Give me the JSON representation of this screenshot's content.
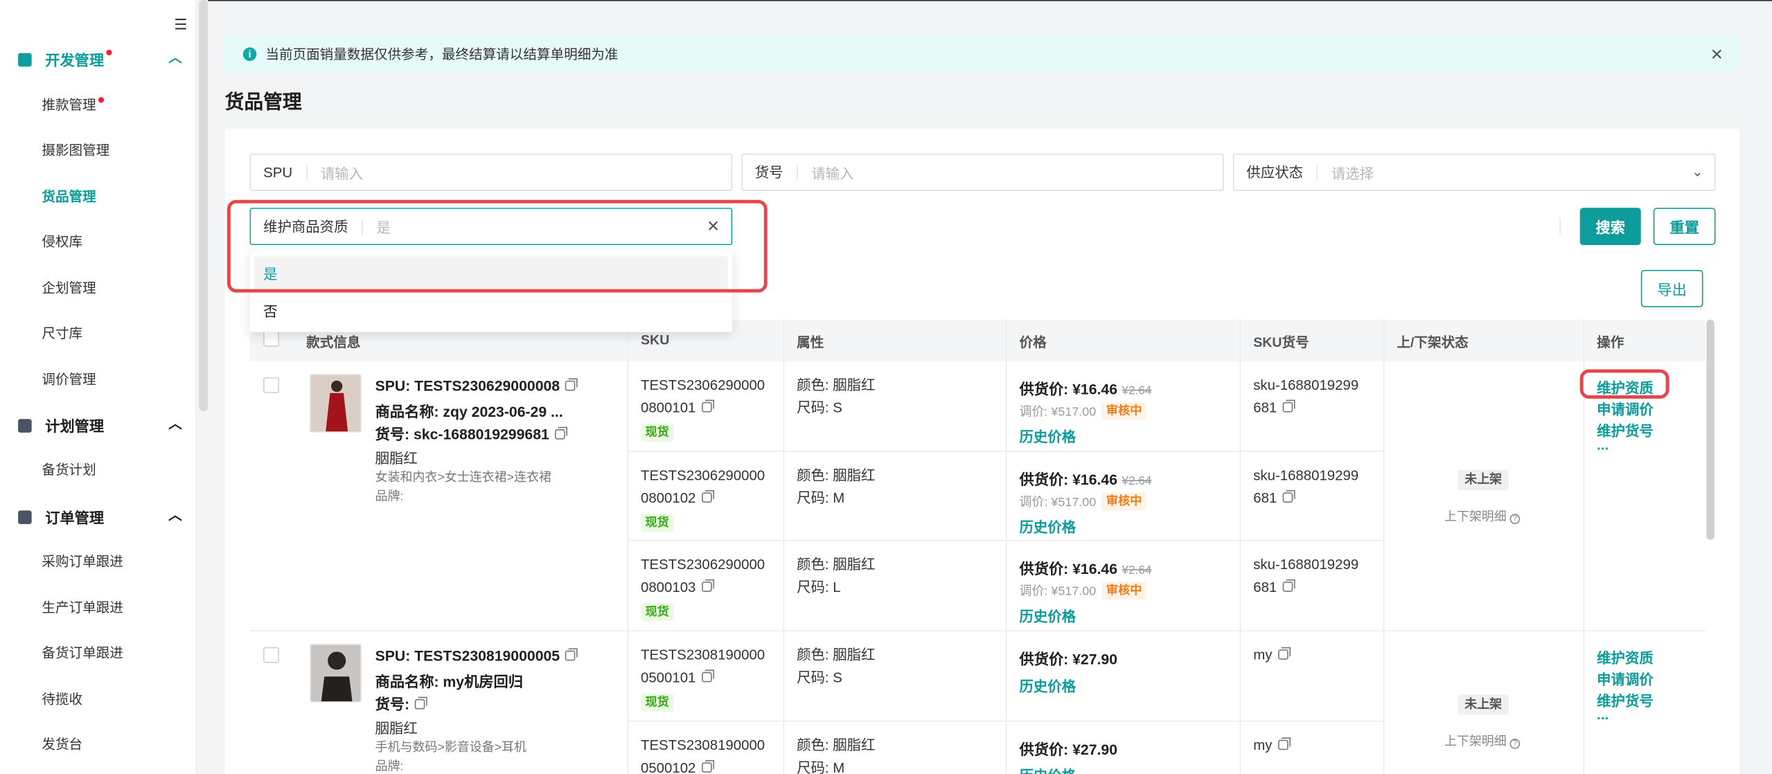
{
  "sidebar": {
    "groups": [
      {
        "label": "开发管理",
        "active": true,
        "has_dot": true
      },
      {
        "label": "计划管理",
        "active": false,
        "has_dot": false
      },
      {
        "label": "订单管理",
        "active": false,
        "has_dot": false
      }
    ],
    "dev_items": [
      "推款管理",
      "摄影图管理",
      "货品管理",
      "侵权库",
      "企划管理",
      "尺寸库",
      "调价管理"
    ],
    "plan_items": [
      "备货计划"
    ],
    "order_items": [
      "采购订单跟进",
      "生产订单跟进",
      "备货订单跟进",
      "待揽收",
      "发货台"
    ],
    "active_item": "货品管理"
  },
  "notice": {
    "text": "当前页面销量数据仅供参考，最终结算请以结算单明细为准",
    "icon": "info-icon",
    "close": "✕"
  },
  "page_title": "货品管理",
  "filters": {
    "spu": {
      "label": "SPU",
      "placeholder": "请输入"
    },
    "item_no": {
      "label": "货号",
      "placeholder": "请输入"
    },
    "supply_status": {
      "label": "供应状态",
      "placeholder": "请选择",
      "suffix": "⌄"
    },
    "qualification": {
      "label": "维护商品资质",
      "value": "是",
      "clear": "✕"
    }
  },
  "dropdown": {
    "options": [
      "是",
      "否"
    ],
    "selected": "是"
  },
  "buttons": {
    "search": "搜索",
    "reset": "重置",
    "export": "导出"
  },
  "table": {
    "headers": [
      "款式信息",
      "SKU",
      "属性",
      "价格",
      "SKU货号",
      "上/下架状态",
      "操作"
    ],
    "products": [
      {
        "spu": "SPU: TESTS230629000008",
        "name": "商品名称: zqy 2023-06-29 ...",
        "item_no": "货号: skc-1688019299681",
        "color": "胭脂红",
        "category": "女装和内衣>女士连衣裙>连衣裙",
        "brand": "品牌:",
        "status": "未上架",
        "status_detail": "上下架明细",
        "actions": [
          "维护资质",
          "申请调价",
          "维护货号",
          "..."
        ],
        "skus": [
          {
            "sku_line1": "TESTS2306290000",
            "sku_line2": "0800101",
            "tag": "现货",
            "attr_color": "颜色: 胭脂红",
            "attr_size": "尺码: S",
            "price_label": "供货价: ",
            "price": "¥16.46",
            "price_old": "¥2.64",
            "adjust": "调价: ¥517.00",
            "review": "审核中",
            "history": "历史价格",
            "sku_no_line1": "sku-1688019299",
            "sku_no_line2": "681"
          },
          {
            "sku_line1": "TESTS2306290000",
            "sku_line2": "0800102",
            "tag": "现货",
            "attr_color": "颜色: 胭脂红",
            "attr_size": "尺码: M",
            "price_label": "供货价: ",
            "price": "¥16.46",
            "price_old": "¥2.64",
            "adjust": "调价: ¥517.00",
            "review": "审核中",
            "history": "历史价格",
            "sku_no_line1": "sku-1688019299",
            "sku_no_line2": "681"
          },
          {
            "sku_line1": "TESTS2306290000",
            "sku_line2": "0800103",
            "tag": "现货",
            "attr_color": "颜色: 胭脂红",
            "attr_size": "尺码: L",
            "price_label": "供货价: ",
            "price": "¥16.46",
            "price_old": "¥2.64",
            "adjust": "调价: ¥517.00",
            "review": "审核中",
            "history": "历史价格",
            "sku_no_line1": "sku-1688019299",
            "sku_no_line2": "681"
          }
        ]
      },
      {
        "spu": "SPU: TESTS230819000005",
        "name": "商品名称: my机房回归",
        "item_no": "货号:",
        "color": "胭脂红",
        "category": "手机与数码>影音设备>耳机",
        "brand": "品牌:",
        "status": "未上架",
        "status_detail": "上下架明细",
        "actions": [
          "维护资质",
          "申请调价",
          "维护货号",
          "..."
        ],
        "skus": [
          {
            "sku_line1": "TESTS2308190000",
            "sku_line2": "0500101",
            "tag": "现货",
            "attr_color": "颜色: 胭脂红",
            "attr_size": "尺码: S",
            "price_label": "供货价: ",
            "price": "¥27.90",
            "history": "历史价格",
            "sku_no_line1": "my"
          },
          {
            "sku_line1": "TESTS2308190000",
            "sku_line2": "0500102",
            "attr_color": "颜色: 胭脂红",
            "attr_size": "尺码: M",
            "price_label": "供货价: ",
            "price": "¥27.90",
            "history": "历史价格",
            "sku_no_line1": "my"
          }
        ]
      }
    ]
  },
  "colors": {
    "accent": "#0e9c9c",
    "highlight": "#e8454a",
    "warning": "#f07e1b",
    "success": "#3ba91a"
  }
}
